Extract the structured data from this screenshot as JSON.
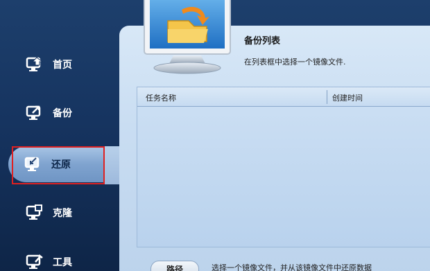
{
  "sidebar": {
    "items": [
      {
        "label": "首页",
        "icon": "home-monitor-icon"
      },
      {
        "label": "备份",
        "icon": "backup-monitor-icon"
      },
      {
        "label": "还原",
        "icon": "restore-monitor-icon",
        "active": true
      },
      {
        "label": "克隆",
        "icon": "clone-monitor-icon"
      },
      {
        "label": "工具",
        "icon": "tools-monitor-icon"
      }
    ]
  },
  "header": {
    "title": "备份列表",
    "subtitle": "在列表框中选择一个镜像文件."
  },
  "list": {
    "columns": [
      "任务名称",
      "创建时间"
    ],
    "rows": []
  },
  "bottom": {
    "path_button_label": "路径",
    "hint": "选择一个镜像文件，并从该镜像文件中还原数据"
  },
  "colors": {
    "sidebar_bg": "#163460",
    "active_tab": "#7fa3cf",
    "content_bg": "#c9ddf2",
    "highlight": "#e02020"
  }
}
